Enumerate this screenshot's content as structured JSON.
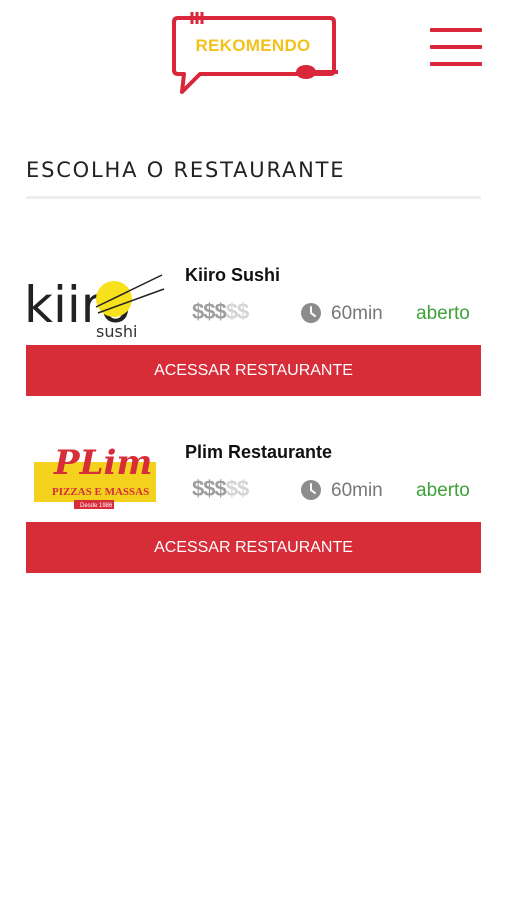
{
  "header": {
    "logo_text": "REKOMENDO",
    "menu_icon": "hamburger-menu-icon"
  },
  "colors": {
    "brand_red": "#d62d39",
    "logo_yellow": "#f2c21c",
    "status_green": "#3fa13b",
    "price_active": "#9e9e9e",
    "price_inactive": "#d4d4d4"
  },
  "page": {
    "title": "ESCOLHA O RESTAURANTE"
  },
  "restaurants": [
    {
      "name": "Kiiro Sushi",
      "logo_text": "kiiro",
      "logo_sub": "sushi",
      "price_active": "$$$",
      "price_inactive": "$$",
      "price_level": 3,
      "price_max": 5,
      "time": "60min",
      "status": "aberto",
      "cta": "ACESSAR RESTAURANTE"
    },
    {
      "name": "Plim Restaurante",
      "logo_text": "PLim",
      "logo_sub": "PIZZAS E MASSAS",
      "logo_tag": "Desde 1986",
      "price_active": "$$$",
      "price_inactive": "$$",
      "price_level": 3,
      "price_max": 5,
      "time": "60min",
      "status": "aberto",
      "cta": "ACESSAR RESTAURANTE"
    }
  ]
}
